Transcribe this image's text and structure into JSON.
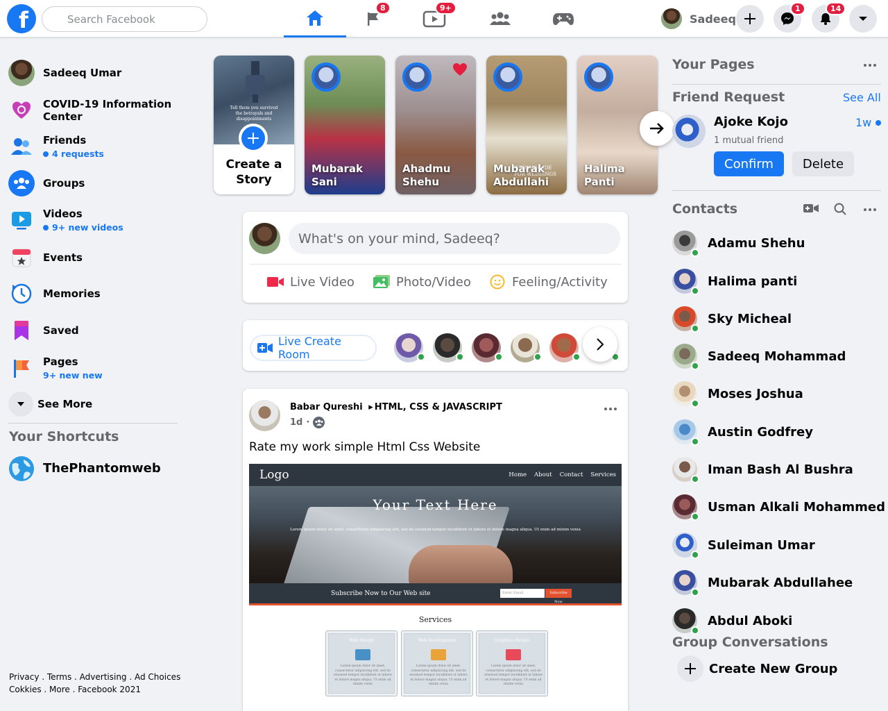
{
  "header": {
    "logo_letter": "f",
    "search_placeholder": "Search Facebook",
    "tabs": [
      {
        "name": "home",
        "badge": ""
      },
      {
        "name": "pages",
        "badge": "8"
      },
      {
        "name": "watch",
        "badge": "9+"
      },
      {
        "name": "groups",
        "badge": ""
      },
      {
        "name": "gaming",
        "badge": ""
      }
    ],
    "profile_name": "Sadeeq",
    "messenger_badge": "1",
    "notifications_badge": "14",
    "accent_color": "#1877f2",
    "badge_color": "#e41e3f"
  },
  "sidebar": {
    "items": [
      {
        "label": "Sadeeq Umar",
        "sub": ""
      },
      {
        "label": "COVID-19 Information Center",
        "sub": ""
      },
      {
        "label": "Friends",
        "sub": "4 requests"
      },
      {
        "label": "Groups",
        "sub": ""
      },
      {
        "label": "Videos",
        "sub": "9+ new videos"
      },
      {
        "label": "Events",
        "sub": ""
      },
      {
        "label": "Memories",
        "sub": ""
      },
      {
        "label": "Saved",
        "sub": ""
      },
      {
        "label": "Pages",
        "sub": "9+ new new"
      },
      {
        "label": "See More",
        "sub": ""
      }
    ],
    "shortcuts_title": "Your Shortcuts",
    "shortcuts": [
      {
        "label": "ThePhantomweb"
      }
    ],
    "footer": "Privacy . Terms . Advertising . Ad Choices Cokkies . More . Facebook 2021"
  },
  "stories": {
    "create_label": "Create a Story",
    "create_overlay": "Tell them you survived the betrayals and disappointments",
    "items": [
      {
        "name": "Mubarak Sani"
      },
      {
        "name": "Ahadmu Shehu"
      },
      {
        "name": "Mubarak Abdullahi",
        "overlay": "WEBSHOP IDE FOR WEDDINGS"
      },
      {
        "name": "Halima Panti"
      }
    ]
  },
  "composer": {
    "placeholder": "What's on your mind, Sadeeq?",
    "actions": [
      {
        "label": "Live Video"
      },
      {
        "label": "Photo/Video"
      },
      {
        "label": "Feeling/Activity"
      }
    ]
  },
  "rooms": {
    "button_label": "Live Create Room"
  },
  "post": {
    "author": "Babar Qureshi",
    "group": "HTML, CSS & JAVASCRIPT",
    "time": "1d",
    "text": "Rate my work simple Html Css Website",
    "mockup": {
      "logo": "Logo",
      "nav": [
        "Home",
        "About",
        "Contact",
        "Services"
      ],
      "hero_title": "Your Text Here",
      "hero_sub": "Lorem ipsum dolor sit amet, consectetur adipisicing elit, sed do eiusmod tempor incididunt ut labore et dolore magna aliqua. Ut enim ad minim venia",
      "subscribe_text": "Subscribe Now to Our Web site",
      "email_placeholder": "Enter Email",
      "subscribe_button": "Subscribe Now",
      "services_title": "Services",
      "services": [
        {
          "title": "Web Design",
          "desc": "Lorem ipsum dolor sit amet, consectetur adipisicing elit, sed do eiusmod tempor incididunt ut labore et dolore magna aliqua. Ut enim ad minim venia"
        },
        {
          "title": "Web Development",
          "desc": "Lorem ipsum dolor sit amet, consectetur adipisicing elit, sed do eiusmod tempor incididunt ut labore et dolore magna aliqua. Ut enim ad minim venia"
        },
        {
          "title": "Graphics Design",
          "desc": "Lorem ipsum dolor sit amet, consectetur adipisicing elit, sed do eiusmod tempor incididunt ut labore et dolore magna aliqua. Ut enim ad minim venia"
        }
      ]
    }
  },
  "right": {
    "pages_title": "Your Pages",
    "friend_request_title": "Friend Request",
    "see_all": "See All",
    "request": {
      "name": "Ajoke Kojo",
      "time": "1w",
      "mutual": "1 mutual friend"
    },
    "confirm_label": "Confirm",
    "delete_label": "Delete",
    "contacts_title": "Contacts",
    "contacts": [
      {
        "name": "Adamu Shehu"
      },
      {
        "name": "Halima panti"
      },
      {
        "name": "Sky Micheal"
      },
      {
        "name": "Sadeeq Mohammad"
      },
      {
        "name": "Moses Joshua"
      },
      {
        "name": "Austin Godfrey"
      },
      {
        "name": "Iman Bash Al Bushra"
      },
      {
        "name": "Usman Alkali Mohammed"
      },
      {
        "name": "Suleiman Umar"
      },
      {
        "name": "Mubarak Abdullahee"
      },
      {
        "name": "Abdul Aboki"
      }
    ],
    "group_conversations_title": "Group Conversations",
    "create_group_label": "Create New Group"
  }
}
